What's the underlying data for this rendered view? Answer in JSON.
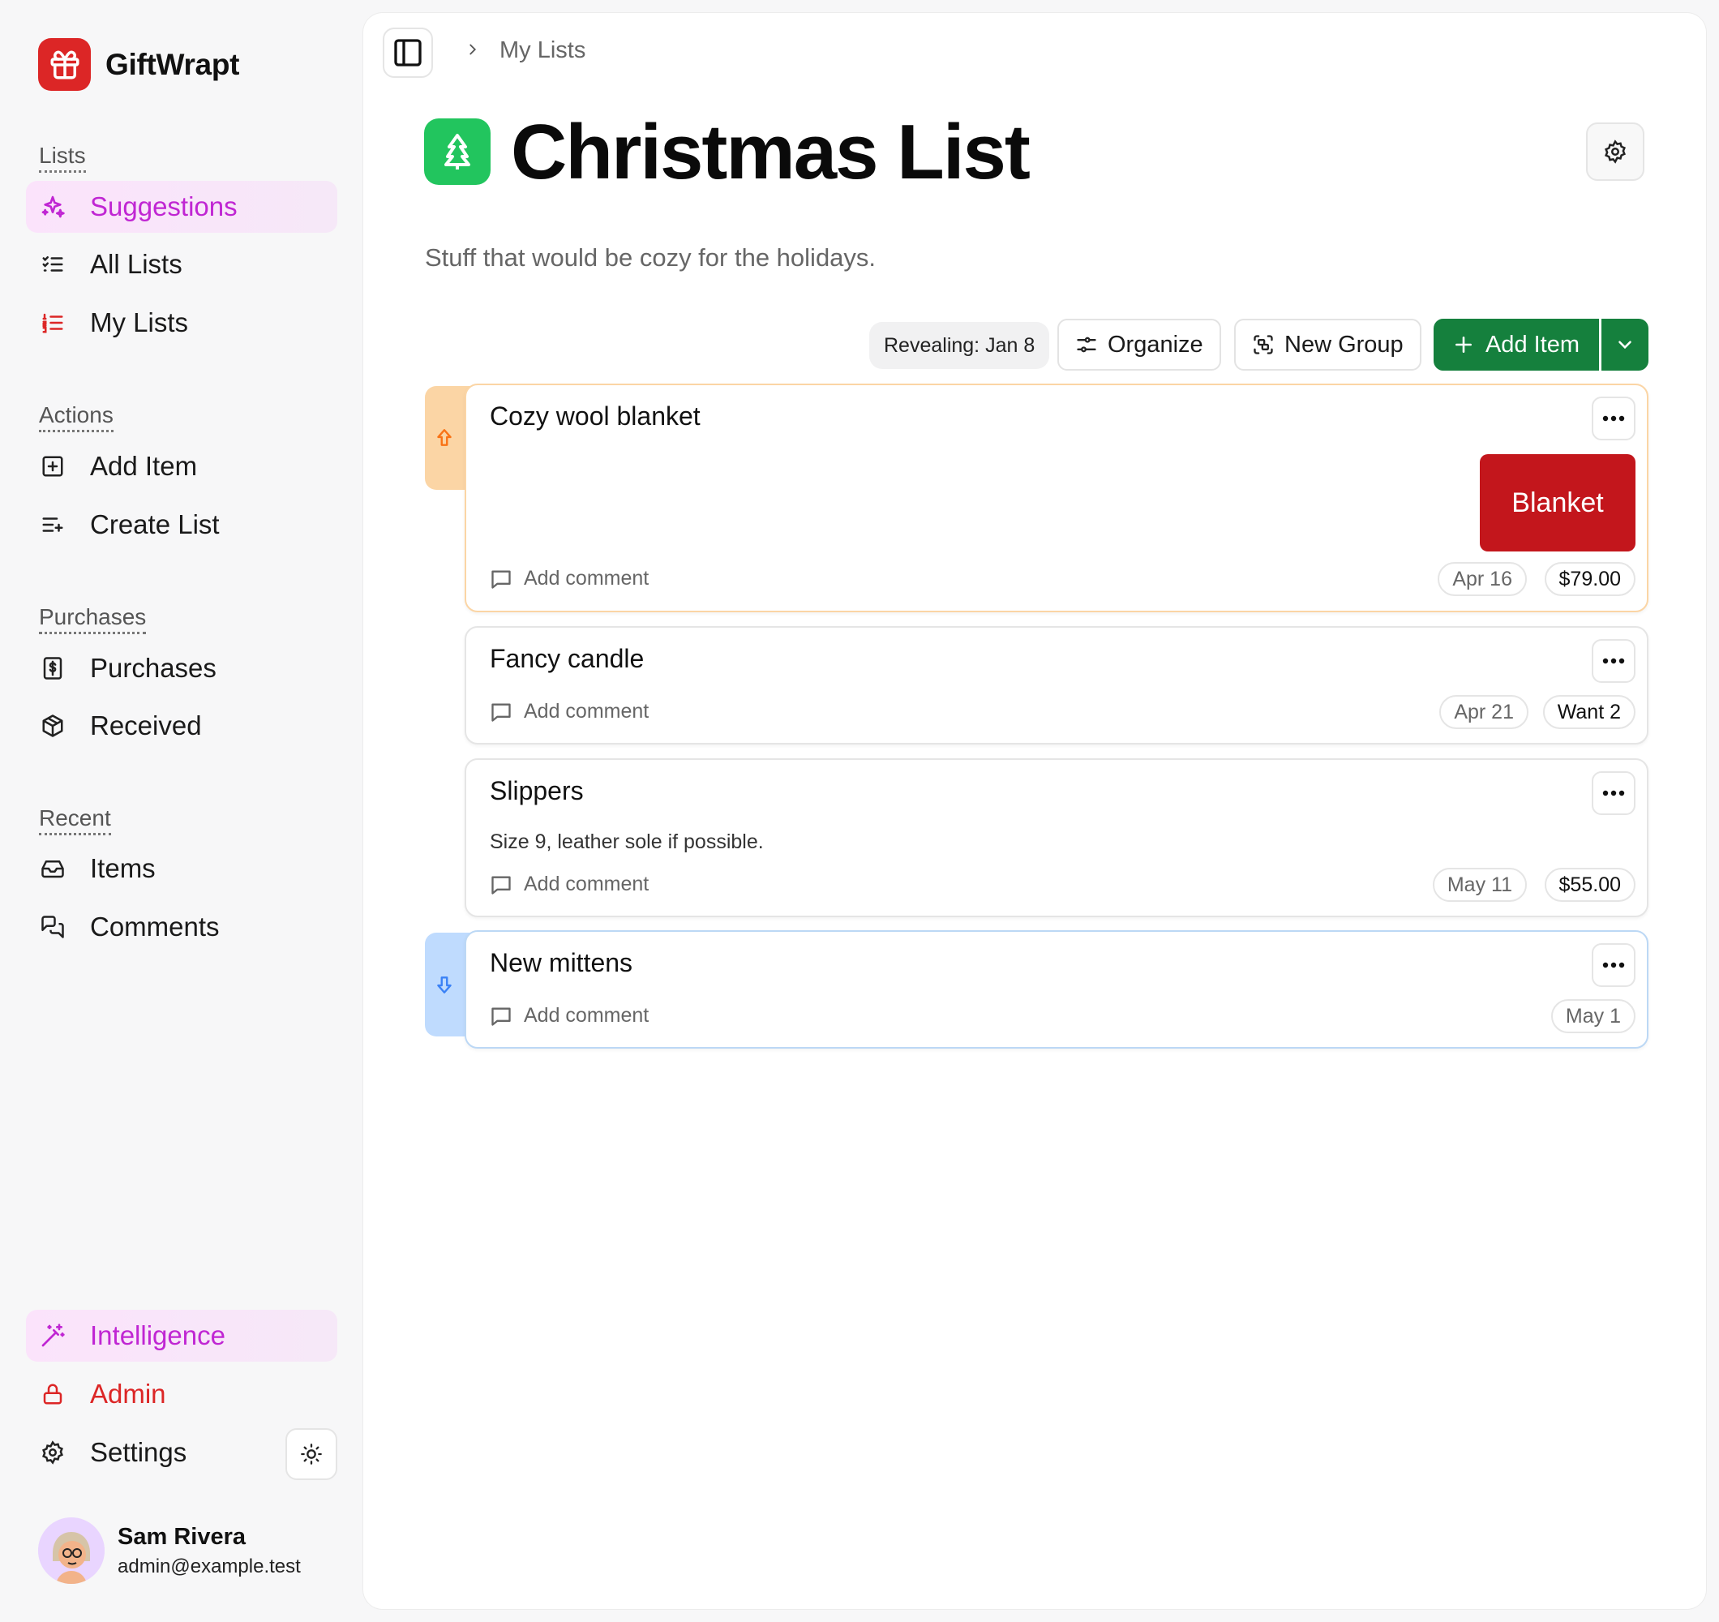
{
  "app": {
    "name": "GiftWrapt"
  },
  "sidebar": {
    "sections": {
      "lists": "Lists",
      "actions": "Actions",
      "purchases": "Purchases",
      "recent": "Recent"
    },
    "items": {
      "suggestions": "Suggestions",
      "all_lists": "All Lists",
      "my_lists": "My Lists",
      "add_item": "Add Item",
      "create_list": "Create List",
      "purchases": "Purchases",
      "received": "Received",
      "items": "Items",
      "comments": "Comments",
      "intelligence": "Intelligence",
      "admin": "Admin",
      "settings": "Settings"
    },
    "user": {
      "name": "Sam Rivera",
      "email": "admin@example.test"
    }
  },
  "breadcrumb": {
    "parent": "My Lists"
  },
  "list": {
    "title": "Christmas List",
    "description": "Stuff that would be cozy for the holidays.",
    "icon": "tree-icon"
  },
  "toolbar": {
    "revealing": "Revealing: Jan 8",
    "organize": "Organize",
    "new_group": "New Group",
    "add_item": "Add Item"
  },
  "items": [
    {
      "name": "Cozy wool blanket",
      "comment": "Add comment",
      "date": "Apr 16",
      "tag": "$79.00",
      "thumb": "Blanket",
      "priority": "high"
    },
    {
      "name": "Fancy candle",
      "comment": "Add comment",
      "date": "Apr 21",
      "tag": "Want 2"
    },
    {
      "name": "Slippers",
      "note": "Size 9, leather sole if possible.",
      "comment": "Add comment",
      "date": "May 11",
      "tag": "$55.00"
    },
    {
      "name": "New mittens",
      "comment": "Add comment",
      "date": "May 1",
      "priority": "low"
    }
  ],
  "colors": {
    "brand": "#dc2626",
    "accent": "#c026d3",
    "primary_button": "#15803d",
    "list_icon": "#22c55e",
    "priority_high": "#f97316",
    "priority_low": "#3b82f6"
  }
}
